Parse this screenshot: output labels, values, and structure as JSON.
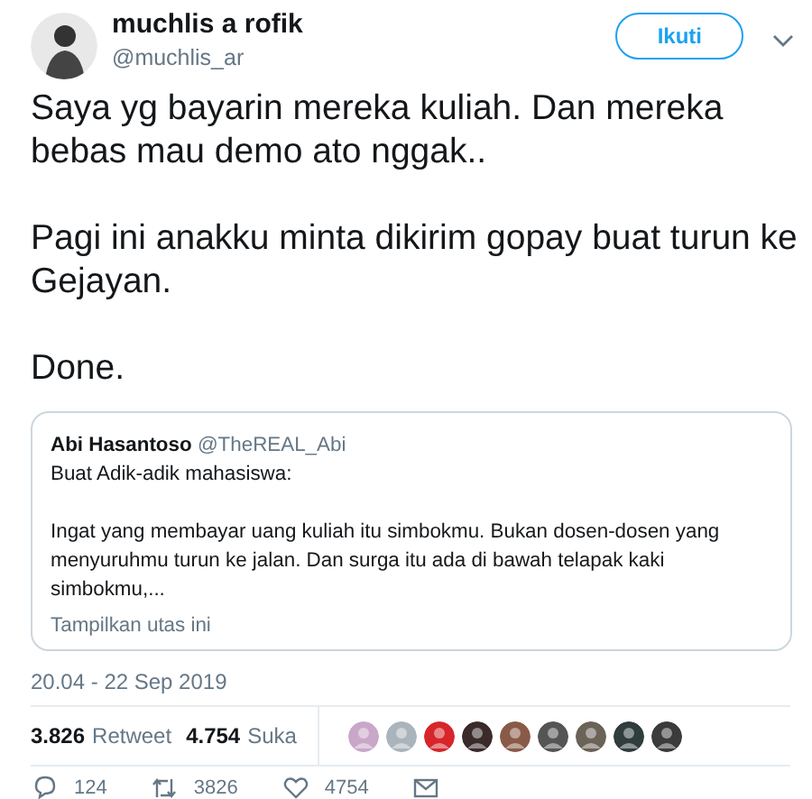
{
  "author": {
    "name": "muchlis a rofik",
    "handle": "@muchlis_ar"
  },
  "follow_button": "Ikuti",
  "tweet_paragraphs": [
    "Saya yg bayarin mereka kuliah. Dan mereka bebas mau demo ato nggak..",
    "Pagi ini anakku minta dikirim gopay buat turun ke Gejayan.",
    "Done."
  ],
  "quoted_tweet": {
    "name": "Abi Hasantoso",
    "handle": "@TheREAL_Abi",
    "paragraphs": [
      "Buat Adik-adik mahasiswa:",
      "Ingat yang membayar uang kuliah itu simbokmu. Bukan dosen-dosen yang menyuruhmu turun ke jalan. Dan surga itu ada di bawah telapak kaki simbokmu,..."
    ],
    "show_thread": "Tampilkan utas ini"
  },
  "timestamp": "20.04 - 22 Sep 2019",
  "stats": [
    {
      "count": "3.826",
      "label": "Retweet"
    },
    {
      "count": "4.754",
      "label": "Suka"
    }
  ],
  "likers": [
    {
      "color": "#c9a7c9"
    },
    {
      "color": "#aab4bc"
    },
    {
      "color": "#d6262b"
    },
    {
      "color": "#3a2a2a"
    },
    {
      "color": "#8a5a48"
    },
    {
      "color": "#555555"
    },
    {
      "color": "#6b6258"
    },
    {
      "color": "#2f3d3c"
    },
    {
      "color": "#3b3b3b"
    }
  ],
  "actions": [
    {
      "kind": "reply",
      "count": "124"
    },
    {
      "kind": "retweet",
      "count": "3826"
    },
    {
      "kind": "like",
      "count": "4754"
    },
    {
      "kind": "message"
    }
  ]
}
